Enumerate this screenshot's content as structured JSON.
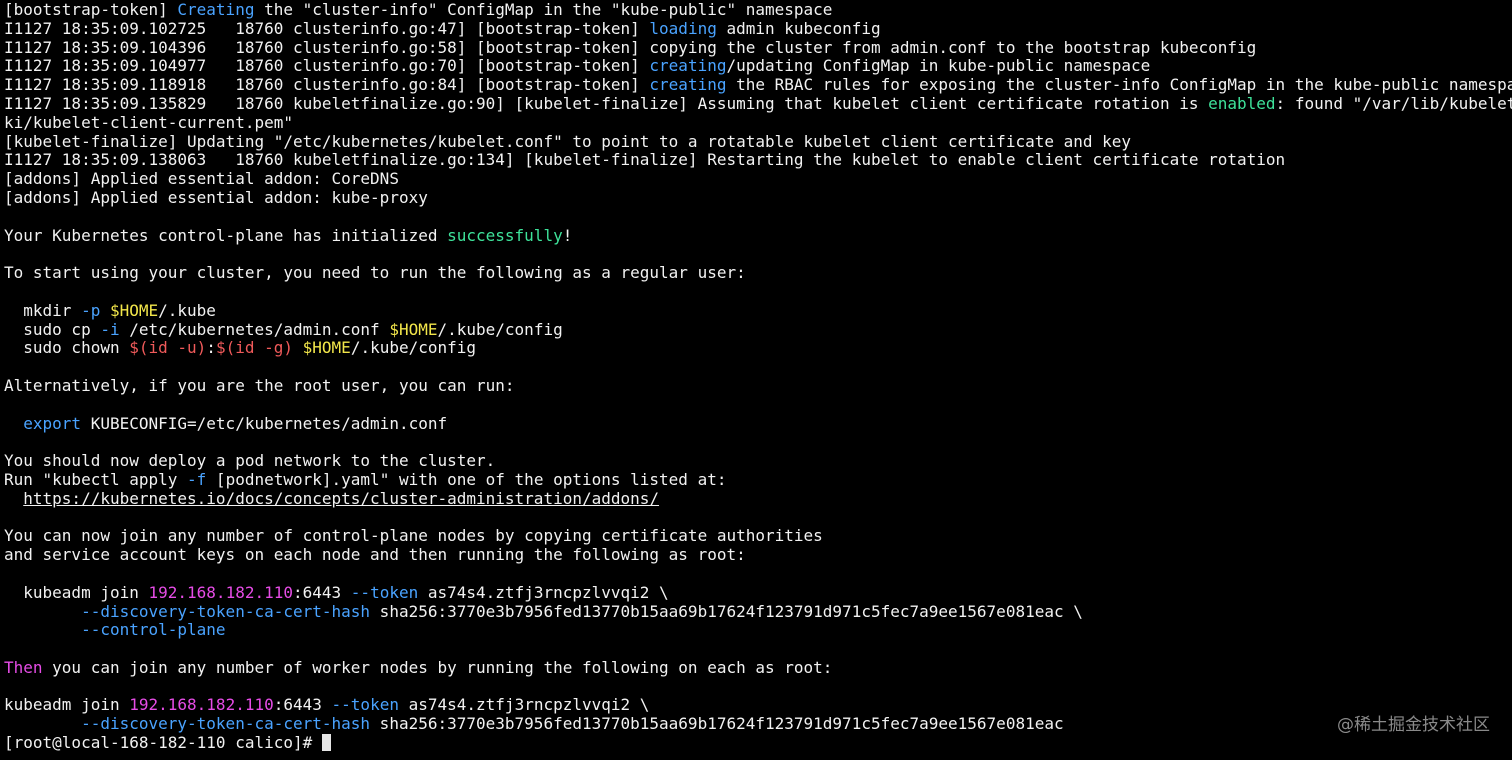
{
  "terminal": {
    "lines": [
      {
        "segs": [
          {
            "t": "[bootstrap-token] ",
            "c": ""
          },
          {
            "t": "Creating",
            "c": "blue"
          },
          {
            "t": " the \"cluster-info\" ConfigMap in the \"kube-public\" namespace",
            "c": ""
          }
        ]
      },
      {
        "segs": [
          {
            "t": "I1127 18:35:09.102725   18760 clusterinfo.go:47] [bootstrap-token] ",
            "c": ""
          },
          {
            "t": "loading",
            "c": "blue"
          },
          {
            "t": " admin kubeconfig",
            "c": ""
          }
        ]
      },
      {
        "segs": [
          {
            "t": "I1127 18:35:09.104396   18760 clusterinfo.go:58] [bootstrap-token] copying the cluster from admin.conf to the bootstrap kubeconfig",
            "c": ""
          }
        ]
      },
      {
        "segs": [
          {
            "t": "I1127 18:35:09.104977   18760 clusterinfo.go:70] [bootstrap-token] ",
            "c": ""
          },
          {
            "t": "creating",
            "c": "blue"
          },
          {
            "t": "/updating ConfigMap in kube-public namespace",
            "c": ""
          }
        ]
      },
      {
        "segs": [
          {
            "t": "I1127 18:35:09.118918   18760 clusterinfo.go:84] [bootstrap-token] ",
            "c": ""
          },
          {
            "t": "creating",
            "c": "blue"
          },
          {
            "t": " the RBAC rules for exposing the cluster-info ConfigMap in the kube-public namespace",
            "c": ""
          }
        ]
      },
      {
        "segs": [
          {
            "t": "I1127 18:35:09.135829   18760 kubeletfinalize.go:90] [kubelet-finalize] Assuming that kubelet client certificate rotation is ",
            "c": ""
          },
          {
            "t": "enabled",
            "c": "green"
          },
          {
            "t": ": found \"/var/lib/kubelet/p",
            "c": ""
          }
        ]
      },
      {
        "segs": [
          {
            "t": "ki/kubelet-client-current.pem\"",
            "c": ""
          }
        ]
      },
      {
        "segs": [
          {
            "t": "[kubelet-finalize] Updating \"/etc/kubernetes/kubelet.conf\" to point to a rotatable kubelet client certificate and key",
            "c": ""
          }
        ]
      },
      {
        "segs": [
          {
            "t": "I1127 18:35:09.138063   18760 kubeletfinalize.go:134] [kubelet-finalize] Restarting the kubelet to enable client certificate rotation",
            "c": ""
          }
        ]
      },
      {
        "segs": [
          {
            "t": "[addons] Applied essential addon: CoreDNS",
            "c": ""
          }
        ]
      },
      {
        "segs": [
          {
            "t": "[addons] Applied essential addon: kube-proxy",
            "c": ""
          }
        ]
      },
      {
        "segs": []
      },
      {
        "segs": [
          {
            "t": "Your Kubernetes control-plane has initialized ",
            "c": ""
          },
          {
            "t": "successfully",
            "c": "green"
          },
          {
            "t": "!",
            "c": ""
          }
        ]
      },
      {
        "segs": []
      },
      {
        "segs": [
          {
            "t": "To start using your cluster, you need to run the following as a regular user:",
            "c": ""
          }
        ]
      },
      {
        "segs": []
      },
      {
        "segs": [
          {
            "t": "  mkdir ",
            "c": ""
          },
          {
            "t": "-p",
            "c": "blue"
          },
          {
            "t": " ",
            "c": ""
          },
          {
            "t": "$HOME",
            "c": "yellow"
          },
          {
            "t": "/.kube",
            "c": ""
          }
        ]
      },
      {
        "segs": [
          {
            "t": "  sudo cp ",
            "c": ""
          },
          {
            "t": "-i",
            "c": "blue"
          },
          {
            "t": " /etc/kubernetes/admin.conf ",
            "c": ""
          },
          {
            "t": "$HOME",
            "c": "yellow"
          },
          {
            "t": "/.kube/config",
            "c": ""
          }
        ]
      },
      {
        "segs": [
          {
            "t": "  sudo chown ",
            "c": ""
          },
          {
            "t": "$(id -u)",
            "c": "red"
          },
          {
            "t": ":",
            "c": ""
          },
          {
            "t": "$(id -g)",
            "c": "red"
          },
          {
            "t": " ",
            "c": ""
          },
          {
            "t": "$HOME",
            "c": "yellow"
          },
          {
            "t": "/.kube/config",
            "c": ""
          }
        ]
      },
      {
        "segs": []
      },
      {
        "segs": [
          {
            "t": "Alternatively, if you are the root user, you can run:",
            "c": ""
          }
        ]
      },
      {
        "segs": []
      },
      {
        "segs": [
          {
            "t": "  ",
            "c": ""
          },
          {
            "t": "export",
            "c": "blue"
          },
          {
            "t": " KUBECONFIG=/etc/kubernetes/admin.conf",
            "c": ""
          }
        ]
      },
      {
        "segs": []
      },
      {
        "segs": [
          {
            "t": "You should now deploy a pod network to the cluster.",
            "c": ""
          }
        ]
      },
      {
        "segs": [
          {
            "t": "Run \"kubectl apply ",
            "c": ""
          },
          {
            "t": "-f",
            "c": "blue"
          },
          {
            "t": " [podnetwork].yaml\" with one of the options listed at:",
            "c": ""
          }
        ]
      },
      {
        "segs": [
          {
            "t": "  ",
            "c": ""
          },
          {
            "t": "https://kubernetes.io/docs/concepts/cluster-administration/addons/",
            "c": "link"
          }
        ]
      },
      {
        "segs": []
      },
      {
        "segs": [
          {
            "t": "You can now join any number of control-plane nodes by copying certificate authorities",
            "c": ""
          }
        ]
      },
      {
        "segs": [
          {
            "t": "and service account keys on each node and then running the following as root:",
            "c": ""
          }
        ]
      },
      {
        "segs": []
      },
      {
        "segs": [
          {
            "t": "  kubeadm join ",
            "c": ""
          },
          {
            "t": "192.168.182.110",
            "c": "magenta"
          },
          {
            "t": ":6443 ",
            "c": ""
          },
          {
            "t": "--token",
            "c": "blue"
          },
          {
            "t": " as74s4.ztfj3rncpzlvvqi2 \\",
            "c": ""
          }
        ]
      },
      {
        "segs": [
          {
            "t": "        ",
            "c": ""
          },
          {
            "t": "--discovery-token-ca-cert-hash",
            "c": "blue"
          },
          {
            "t": " sha256:3770e3b7956fed13770b15aa69b17624f123791d971c5fec7a9ee1567e081eac \\",
            "c": ""
          }
        ]
      },
      {
        "segs": [
          {
            "t": "        ",
            "c": ""
          },
          {
            "t": "--control-plane",
            "c": "blue"
          }
        ]
      },
      {
        "segs": []
      },
      {
        "segs": [
          {
            "t": "Then",
            "c": "magenta"
          },
          {
            "t": " you can join any number of worker nodes by running the following on each as root:",
            "c": ""
          }
        ]
      },
      {
        "segs": []
      },
      {
        "segs": [
          {
            "t": "kubeadm join ",
            "c": ""
          },
          {
            "t": "192.168.182.110",
            "c": "magenta"
          },
          {
            "t": ":6443 ",
            "c": ""
          },
          {
            "t": "--token",
            "c": "blue"
          },
          {
            "t": " as74s4.ztfj3rncpzlvvqi2 \\",
            "c": ""
          }
        ]
      },
      {
        "segs": [
          {
            "t": "        ",
            "c": ""
          },
          {
            "t": "--discovery-token-ca-cert-hash",
            "c": "blue"
          },
          {
            "t": " sha256:3770e3b7956fed13770b15aa69b17624f123791d971c5fec7a9ee1567e081eac",
            "c": ""
          }
        ]
      }
    ],
    "prompt": "[root@local-168-182-110 calico]# "
  },
  "watermark": "@稀土掘金技术社区",
  "colors": {
    "background": "#000000",
    "foreground": "#f2f2f2",
    "blue": "#4aa3ff",
    "green": "#3ee29a",
    "yellow": "#f2e64a",
    "red": "#f05a5a",
    "magenta": "#e64ce6"
  }
}
